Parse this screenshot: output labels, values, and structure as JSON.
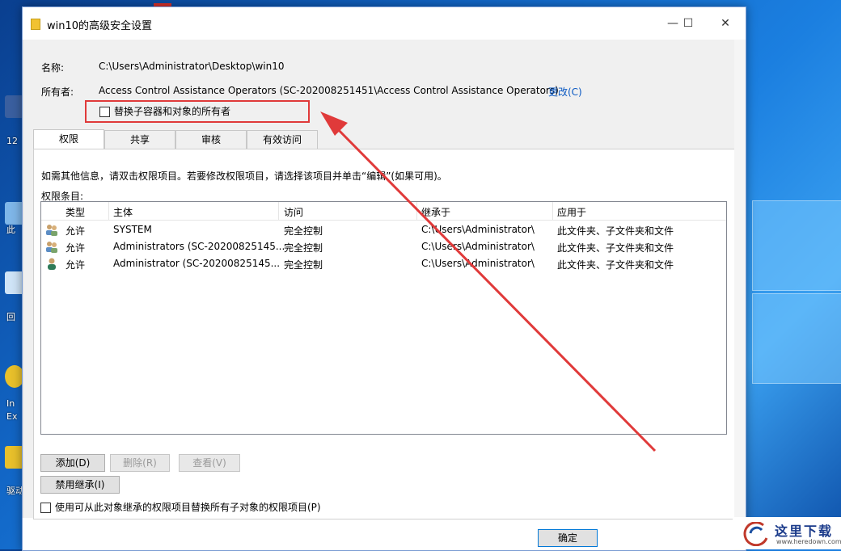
{
  "window": {
    "title": "win10的高级安全设置",
    "minimize": "—",
    "maximize": "☐",
    "close": "✕"
  },
  "info": {
    "name_label": "名称:",
    "name_value": "C:\\Users\\Administrator\\Desktop\\win10",
    "owner_label": "所有者:",
    "owner_value": "Access Control Assistance Operators (SC-202008251451\\Access Control Assistance Operators)",
    "owner_change": "更改(C)",
    "replace_owner": "替换子容器和对象的所有者"
  },
  "tabs": [
    "权限",
    "共享",
    "审核",
    "有效访问"
  ],
  "panel": {
    "hint": "如需其他信息，请双击权限项目。若要修改权限项目，请选择该项目并单击“编辑”(如果可用)。",
    "entries_label": "权限条目:"
  },
  "columns": [
    "类型",
    "主体",
    "访问",
    "继承于",
    "应用于"
  ],
  "rows": [
    {
      "type": "允许",
      "principal": "SYSTEM",
      "access": "完全控制",
      "inherited": "C:\\Users\\Administrator\\",
      "applies": "此文件夹、子文件夹和文件",
      "icon": "users-icon"
    },
    {
      "type": "允许",
      "principal": "Administrators (SC-20200825145...",
      "access": "完全控制",
      "inherited": "C:\\Users\\Administrator\\",
      "applies": "此文件夹、子文件夹和文件",
      "icon": "users-icon"
    },
    {
      "type": "允许",
      "principal": "Administrator (SC-20200825145...",
      "access": "完全控制",
      "inherited": "C:\\Users\\Administrator\\",
      "applies": "此文件夹、子文件夹和文件",
      "icon": "user-icon"
    }
  ],
  "buttons": {
    "add": "添加(D)",
    "remove": "删除(R)",
    "view": "查看(V)",
    "disable_inherit": "禁用继承(I)",
    "ok": "确定"
  },
  "replace_child": "使用可从此对象继承的权限项目替换所有子对象的权限项目(P)",
  "desktop": {
    "labels": [
      "12",
      "此",
      "回",
      "In",
      "Ex",
      "驱动"
    ]
  },
  "watermark": {
    "brand": "这里下载",
    "url": "www.heredown.com"
  },
  "colors": {
    "accent_red": "#e03a3a",
    "link": "#0a58c2"
  }
}
